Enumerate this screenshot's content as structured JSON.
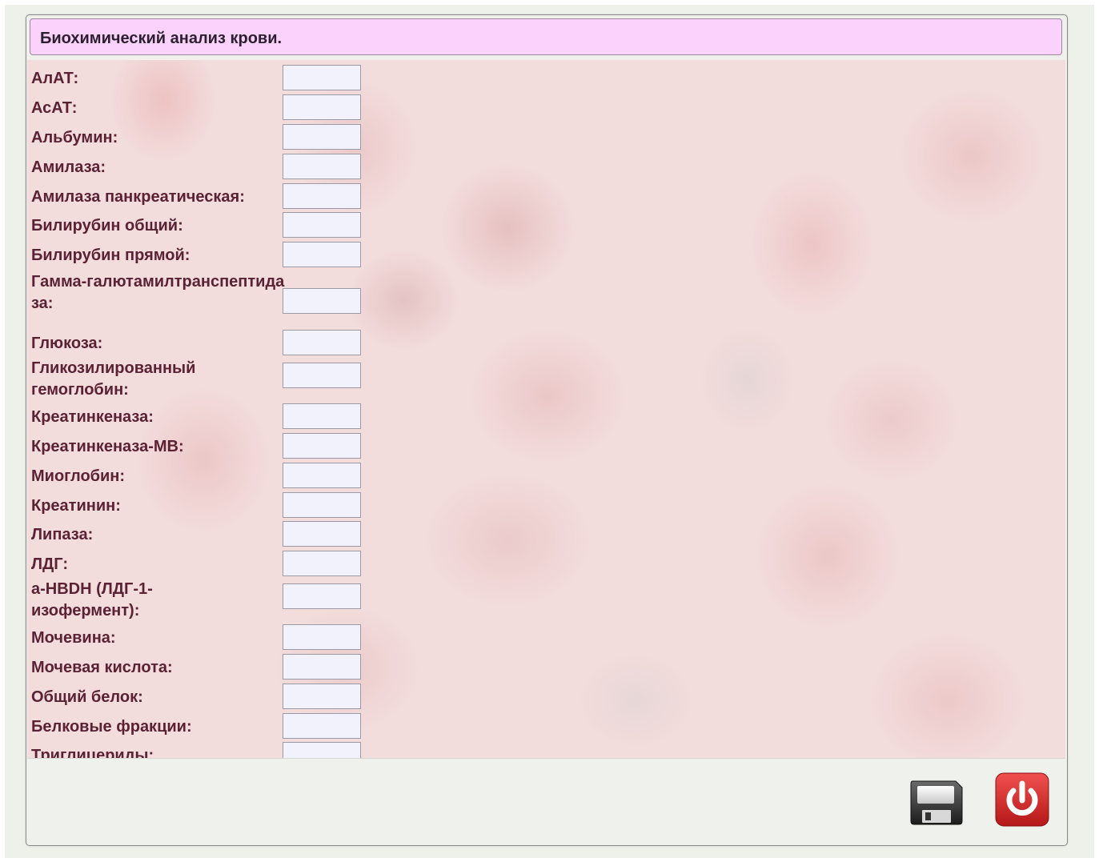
{
  "window": {
    "title": "Биохимический анализ крови."
  },
  "fields": [
    {
      "label": "АлАТ:",
      "value": ""
    },
    {
      "label": "АсАТ:",
      "value": ""
    },
    {
      "label": "Альбумин:",
      "value": ""
    },
    {
      "label": "Амилаза:",
      "value": ""
    },
    {
      "label": "Амилаза панкреатическая:",
      "value": ""
    },
    {
      "label": "Билирубин общий:",
      "value": ""
    },
    {
      "label": "Билирубин прямой:",
      "value": ""
    },
    {
      "label": "Гамма-галютамилтранспептидаза:",
      "value": ""
    },
    {
      "label": "Глюкоза:",
      "value": ""
    },
    {
      "label": "Гликозилированный гемоглобин:",
      "value": ""
    },
    {
      "label": "Креатинкеназа:",
      "value": ""
    },
    {
      "label": "Креатинкеназа-MB:",
      "value": ""
    },
    {
      "label": "Миоглобин:",
      "value": ""
    },
    {
      "label": "Креатинин:",
      "value": ""
    },
    {
      "label": "Липаза:",
      "value": ""
    },
    {
      "label": "ЛДГ:",
      "value": ""
    },
    {
      "label": "a-HBDH (ЛДГ-1-изофермент):",
      "value": ""
    },
    {
      "label": "Мочевина:",
      "value": ""
    },
    {
      "label": "Мочевая кислота:",
      "value": ""
    },
    {
      "label": "Общий белок:",
      "value": ""
    },
    {
      "label": "Белковые фракции:",
      "value": ""
    },
    {
      "label": "Триглицериды:",
      "value": ""
    }
  ],
  "footer": {
    "save_icon": "floppy-disk-icon",
    "power_icon": "power-icon"
  },
  "colors": {
    "title_bg": "#fbd2fb",
    "label": "#5a2234",
    "input_bg": "#f2f2fd",
    "power_red": "#d42a2a"
  }
}
